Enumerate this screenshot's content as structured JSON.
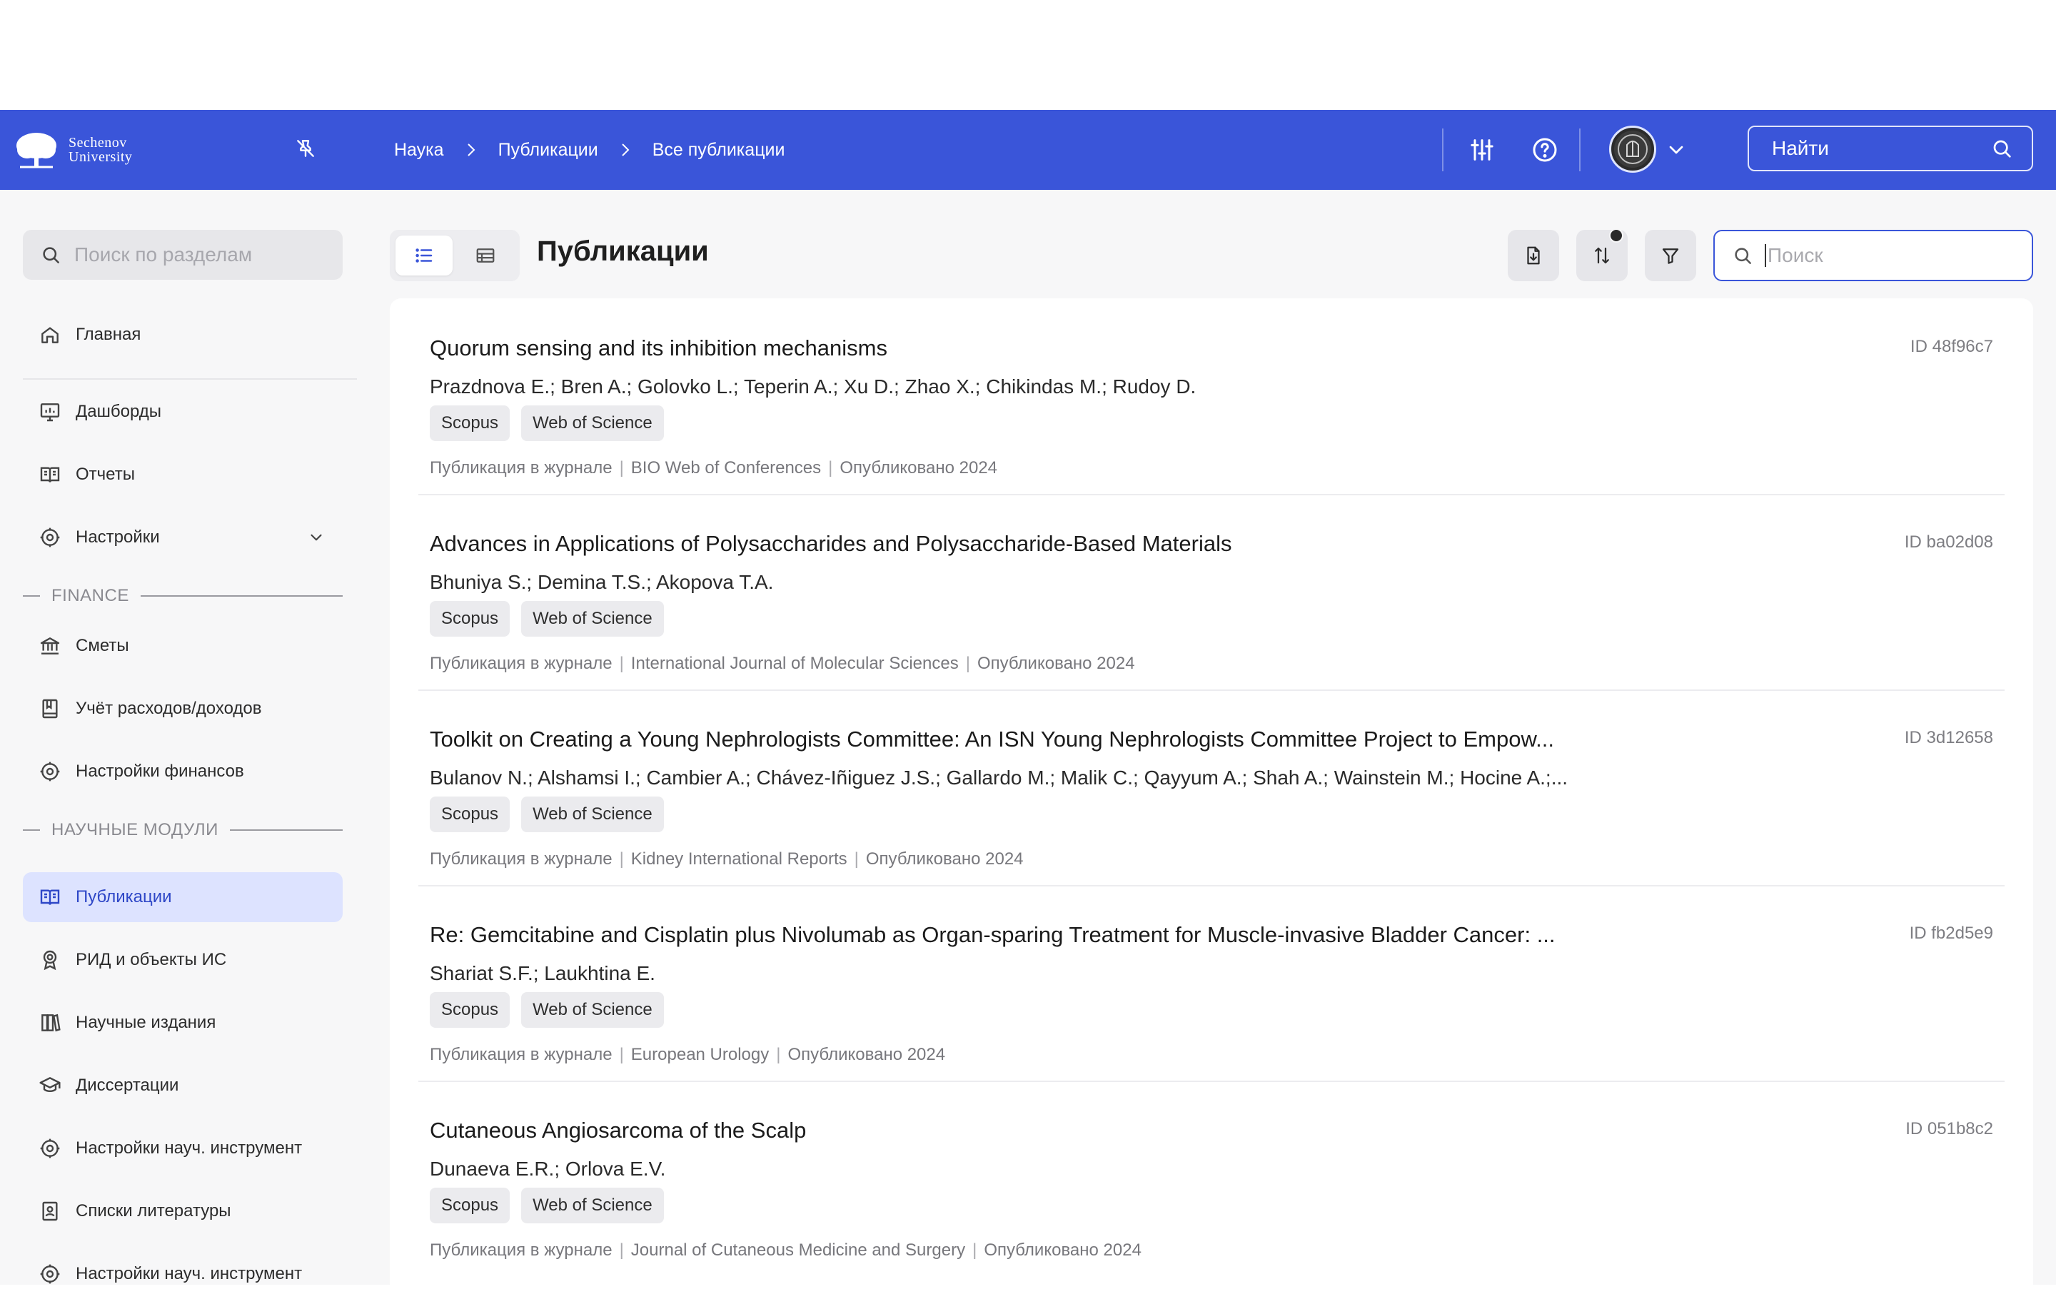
{
  "header": {
    "logo_text_1": "Sechenov",
    "logo_text_2": "University",
    "breadcrumbs": [
      "Наука",
      "Публикации",
      "Все публикации"
    ],
    "search_button_label": "Найти"
  },
  "sidebar": {
    "search_placeholder": "Поиск по разделам",
    "items": [
      {
        "label": "Главная",
        "icon": "home-icon"
      },
      {
        "label": "Дашборды",
        "icon": "dashboard-icon"
      },
      {
        "label": "Отчеты",
        "icon": "book-icon"
      },
      {
        "label": "Настройки",
        "icon": "gear-icon"
      },
      {
        "label": "Сметы",
        "icon": "bank-icon"
      },
      {
        "label": "Учёт расходов/доходов",
        "icon": "ledger-icon"
      },
      {
        "label": "Настройки финансов",
        "icon": "gear-icon"
      },
      {
        "label": "Публикации",
        "icon": "book-icon"
      },
      {
        "label": "РИД и объекты ИС",
        "icon": "award-icon"
      },
      {
        "label": "Научные издания",
        "icon": "books-icon"
      },
      {
        "label": "Диссертации",
        "icon": "graduation-cap-icon"
      },
      {
        "label": "Настройки науч. инструмент",
        "icon": "gear-icon"
      },
      {
        "label": "Списки литературы",
        "icon": "contacts-book-icon"
      },
      {
        "label": "Настройки науч. инструмент",
        "icon": "gear-icon"
      }
    ],
    "sections": [
      "FINANCE",
      "НАУЧНЫЕ МОДУЛИ"
    ],
    "active_item": "Публикации"
  },
  "main": {
    "title": "Публикации",
    "search_placeholder": "Поиск",
    "publications": [
      {
        "title": "Quorum sensing and its inhibition mechanisms",
        "id": "ID 48f96c7",
        "authors": "Prazdnova E.; Bren A.; Golovko L.; Teperin A.; Xu D.; Zhao X.; Chikindas M.; Rudoy D.",
        "tags": [
          "Scopus",
          "Web of Science"
        ],
        "type": "Публикация в журнале",
        "source": "BIO Web of Conferences",
        "published": "Опубликовано 2024"
      },
      {
        "title": "Advances in Applications of Polysaccharides and Polysaccharide-Based Materials",
        "id": "ID ba02d08",
        "authors": "Bhuniya S.; Demina T.S.; Akopova T.A.",
        "tags": [
          "Scopus",
          "Web of Science"
        ],
        "type": "Публикация в журнале",
        "source": "International Journal of Molecular Sciences",
        "published": "Опубликовано 2024"
      },
      {
        "title": "Toolkit on Creating a Young Nephrologists Committee: An ISN Young Nephrologists Committee Project to Empow...",
        "id": "ID 3d12658",
        "authors": "Bulanov N.; Alshamsi I.; Cambier A.; Chávez-Iñiguez J.S.; Gallardo M.; Malik C.; Qayyum A.; Shah A.; Wainstein M.; Hocine A.;...",
        "tags": [
          "Scopus",
          "Web of Science"
        ],
        "type": "Публикация в журнале",
        "source": "Kidney International Reports",
        "published": "Опубликовано 2024"
      },
      {
        "title": "Re: Gemcitabine and Cisplatin plus Nivolumab as Organ-sparing Treatment for Muscle-invasive Bladder Cancer: ...",
        "id": "ID fb2d5e9",
        "authors": "Shariat S.F.; Laukhtina E.",
        "tags": [
          "Scopus",
          "Web of Science"
        ],
        "type": "Публикация в журнале",
        "source": "European Urology",
        "published": "Опубликовано 2024"
      },
      {
        "title": "Cutaneous Angiosarcoma of the Scalp",
        "id": "ID 051b8c2",
        "authors": "Dunaeva E.R.; Orlova E.V.",
        "tags": [
          "Scopus",
          "Web of Science"
        ],
        "type": "Публикация в журнале",
        "source": "Journal of Cutaneous Medicine and Surgery",
        "published": "Опубликовано 2024"
      }
    ]
  },
  "colors": {
    "brand": "#3a55d9",
    "active_bg": "#dde3ff",
    "page_bg": "#f7f7f8"
  }
}
